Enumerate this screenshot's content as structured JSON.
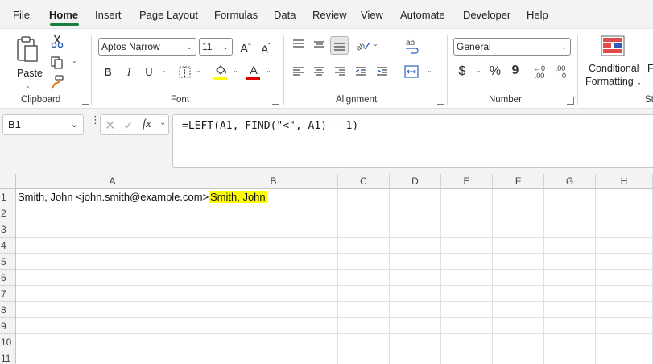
{
  "menu": {
    "tabs": [
      "File",
      "Home",
      "Insert",
      "Page Layout",
      "Formulas",
      "Data",
      "Review",
      "View",
      "Automate",
      "Developer",
      "Help"
    ],
    "active": "Home"
  },
  "ribbon": {
    "clipboard": {
      "label": "Clipboard",
      "paste_label": "Paste"
    },
    "font": {
      "label": "Font",
      "font_name": "Aptos Narrow",
      "font_size": "11",
      "bold": "B",
      "italic": "I",
      "underline": "U",
      "grow": "A",
      "shrink": "A",
      "font_color_letter": "A"
    },
    "alignment": {
      "label": "Alignment"
    },
    "number": {
      "label": "Number",
      "format": "General",
      "currency": "$",
      "percent": "%",
      "comma": "9",
      "inc_decimal": "←0 .00",
      "dec_decimal": ".00 →0"
    },
    "styles": {
      "conditional_line1": "Conditional",
      "conditional_line2": "Formatting",
      "next_partial": "F",
      "next_group_partial": "St"
    },
    "colors": {
      "highlight": "#ffff00",
      "font_color": "#e00000",
      "accent": "#1b7c3f"
    }
  },
  "formula_bar": {
    "name_box": "B1",
    "fx": "fx",
    "formula": "=LEFT(A1, FIND(\"<\", A1) - 1)"
  },
  "sheet": {
    "columns": [
      "A",
      "B",
      "C",
      "D",
      "E",
      "F",
      "G",
      "H"
    ],
    "rows": [
      "1",
      "2",
      "3",
      "4",
      "5",
      "6",
      "7",
      "8",
      "9",
      "10",
      "11"
    ],
    "cells": {
      "A1": "Smith, John <john.smith@example.com>",
      "B1": "Smith, John"
    },
    "b1_highlight": "#ffff00"
  }
}
